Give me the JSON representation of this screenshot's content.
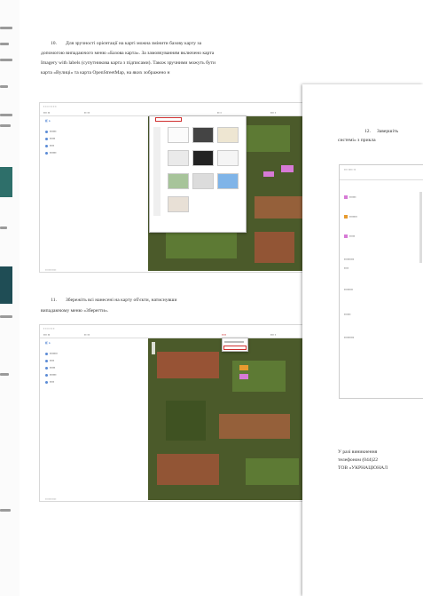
{
  "page1": {
    "step10": {
      "number": "10.",
      "lines": [
        "Для зручності орієнтації на карті можна змінити базову карту за",
        "допомогою випадаючого меню «Базова карта». За замовчуванням включено карта",
        "Imagery with labels (супутникова карта з підписами). Також зручними можуть бути",
        "карта «Вулиці» та карта OpenStreetMap, на яких зображено н"
      ]
    },
    "step11": {
      "number": "11.",
      "lines": [
        "Збережіть всі нанесені на карту об'єкти, натиснувши",
        "випадаючому меню «Зберегти»."
      ]
    }
  },
  "page2": {
    "step12": {
      "number": "12.",
      "lines": [
        "Завершіть",
        "системі» з прикла"
      ]
    },
    "footer_lines": [
      "У разі виникнення",
      "телефоном (044)22",
      "ТОВ «УКРНАЦІОНАЛ"
    ]
  },
  "colors": {
    "map_base": "#4b5a2a",
    "field_red": "#b0523a",
    "field_green": "#5d7a34",
    "highlight_pink": "#d77ad6",
    "accent_red": "#d03030"
  }
}
